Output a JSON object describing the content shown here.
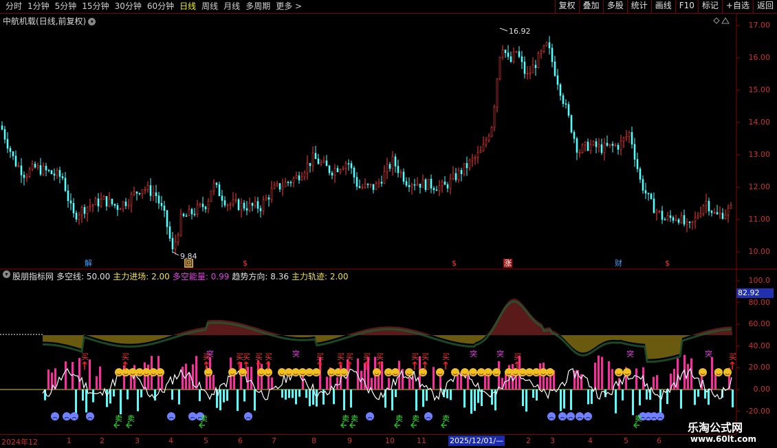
{
  "toolbar": {
    "periods": [
      "分时",
      "1分钟",
      "5分钟",
      "15分钟",
      "30分钟",
      "60分钟",
      "日线",
      "周线",
      "月线",
      "多周期",
      "更多"
    ],
    "active_period": "日线",
    "buttons": [
      "复权",
      "叠加",
      "多股",
      "统计",
      "画线",
      "F10",
      "标记",
      "+自选",
      "返回"
    ]
  },
  "stock": {
    "name": "中航机载",
    "mode": "(日线,前复权)",
    "price_axis": [
      "17.00",
      "16.00",
      "15.00",
      "14.00",
      "13.00",
      "12.00",
      "11.00",
      "10.00"
    ],
    "high_label": "16.92",
    "low_label": "9.84",
    "events": [
      {
        "text": "解",
        "color": "#40a0ff",
        "bg": "#000"
      },
      {
        "text": "回",
        "color": "#000",
        "bg": "#d0a040"
      },
      {
        "text": "$",
        "color": "#ff3030",
        "bg": "#000"
      },
      {
        "text": "$",
        "color": "#ff3030",
        "bg": "#000"
      },
      {
        "text": "涨",
        "color": "#fff",
        "bg": "#a01010"
      },
      {
        "text": "财",
        "color": "#40a0ff",
        "bg": "#000"
      },
      {
        "text": "$",
        "color": "#ff3030",
        "bg": "#000"
      }
    ]
  },
  "indicator": {
    "name": "股朋指标网",
    "items": [
      {
        "label": "多空线:",
        "value": "50.00",
        "color": "#e0e0e0"
      },
      {
        "label": "主力进场:",
        "value": "2.00",
        "color": "#f0e040"
      },
      {
        "label": "多空能量:",
        "value": "0.99",
        "color": "#e040e0"
      },
      {
        "label": "趋势方向:",
        "value": "8.36",
        "color": "#e0e0e0"
      },
      {
        "label": "主力轨迹:",
        "value": "2.00",
        "color": "#f0e040"
      }
    ],
    "axis": [
      "100.0",
      "80.00",
      "60.00",
      "40.00",
      "20.00",
      "0.00",
      "-20.00"
    ],
    "current_value": "82.92",
    "signal_buy": "买",
    "signal_break": "突",
    "signal_sell": "卖"
  },
  "date_axis": {
    "labels": [
      "2024年12",
      "1",
      "2",
      "3",
      "4",
      "5",
      "6",
      "7",
      "8",
      "9",
      "10",
      "11",
      "2",
      "3",
      "4",
      "5",
      "6"
    ],
    "cursor_label": "2025/12/01/—"
  },
  "watermark": {
    "line1": "乐淘公式网",
    "line2": "www.60lt.com"
  },
  "colors": {
    "up": "#ff3b3b",
    "down": "#54ffff",
    "axis": "#8a0000",
    "accent": "#f0f000"
  }
}
